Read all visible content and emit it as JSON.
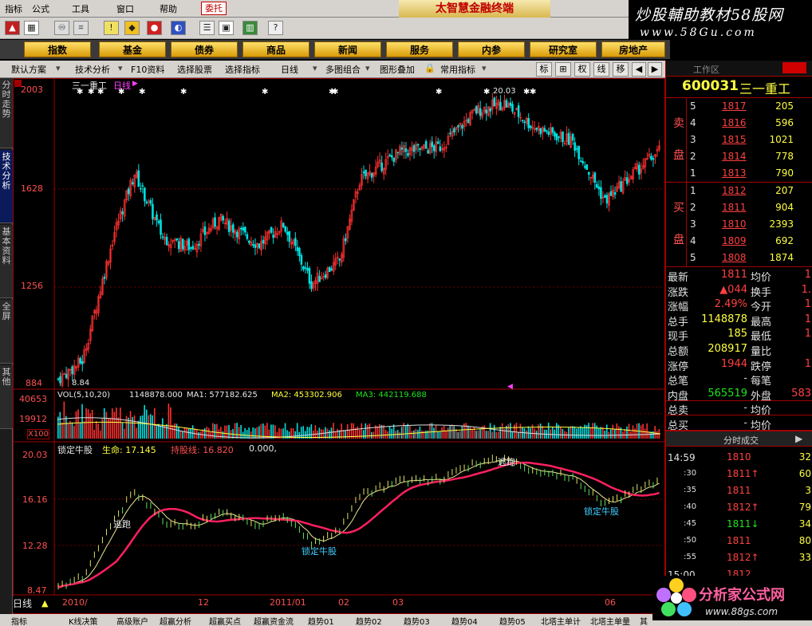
{
  "menubar": {
    "items": [
      "指标",
      "公式",
      "工具",
      "窗口",
      "帮助"
    ],
    "wt": "委托",
    "title": "太智慧金融终端"
  },
  "brand": {
    "line1": "炒股輔助教材58股网",
    "line2": "www.58Gu.com"
  },
  "nav": [
    "指数",
    "基金",
    "债券",
    "商品",
    "新闻",
    "服务",
    "内参",
    "研究室",
    "房地产"
  ],
  "toolbar2": {
    "items": [
      "默认方案",
      "技术分析",
      "F10资料",
      "选择股票",
      "选择指标",
      "日线",
      "多图组合",
      "图形叠加",
      "常用指标"
    ],
    "right": [
      "标",
      "窗",
      "权",
      "线",
      "移"
    ]
  },
  "sidebar": [
    {
      "label": "分时走势"
    },
    {
      "label": "技术分析"
    },
    {
      "label": "基本资料"
    },
    {
      "label": "全屏"
    },
    {
      "label": "其他"
    }
  ],
  "kline": {
    "title": "三一重工",
    "period": "日线",
    "high_mark": "20.03",
    "low_mark": "8.84",
    "yticks": [
      "2003",
      "1628",
      "1256",
      "884"
    ]
  },
  "vol": {
    "label": "VOL(5,10,20)",
    "val": "1148878.000",
    "ma1": "MA1: 577182.625",
    "ma2": "MA2: 453302.906",
    "ma3": "MA3: 442119.688",
    "yticks": [
      "40653",
      "19912",
      "X100"
    ]
  },
  "ind": {
    "name": "锁定牛股",
    "s1": "生命: 17.145",
    "s2": "持股线: 16.820",
    "s3": "0.000,",
    "yticks": [
      "20.03",
      "16.16",
      "12.28",
      "8.47"
    ],
    "ann": [
      "逃跑",
      "逃跑",
      "锁定牛股",
      "锁定牛股"
    ]
  },
  "xaxis": {
    "period": "日线",
    "labels": [
      "2010/",
      "12",
      "2011/01",
      "02",
      "03",
      "",
      "06"
    ]
  },
  "quote": {
    "area": "工作区",
    "code": "600031",
    "name": "三一重工",
    "sell_label": [
      "卖",
      "盘"
    ],
    "buy_label": [
      "买",
      "盘"
    ],
    "sells": [
      {
        "lv": "5",
        "p": "1817",
        "v": "205"
      },
      {
        "lv": "4",
        "p": "1816",
        "v": "596"
      },
      {
        "lv": "3",
        "p": "1815",
        "v": "1021"
      },
      {
        "lv": "2",
        "p": "1814",
        "v": "778"
      },
      {
        "lv": "1",
        "p": "1813",
        "v": "790"
      }
    ],
    "buys": [
      {
        "lv": "1",
        "p": "1812",
        "v": "207"
      },
      {
        "lv": "2",
        "p": "1811",
        "v": "904"
      },
      {
        "lv": "3",
        "p": "1810",
        "v": "2393"
      },
      {
        "lv": "4",
        "p": "1809",
        "v": "692"
      },
      {
        "lv": "5",
        "p": "1808",
        "v": "1874"
      }
    ],
    "stats": [
      {
        "k1": "最新",
        "v1": "1811",
        "k2": "均价",
        "v2": "1"
      },
      {
        "k1": "涨跌",
        "v1": "▲044",
        "k2": "换手",
        "v2": "1."
      },
      {
        "k1": "涨幅",
        "v1": "2.49%",
        "k2": "今开",
        "v2": "1"
      },
      {
        "k1": "总手",
        "v1": "1148878",
        "k2": "最高",
        "v2": "1"
      },
      {
        "k1": "现手",
        "v1": "185",
        "k2": "最低",
        "v2": "1"
      },
      {
        "k1": "总额",
        "v1": "208917",
        "k2": "量比",
        "v2": ""
      },
      {
        "k1": "涨停",
        "v1": "1944",
        "k2": "跌停",
        "v2": "1"
      },
      {
        "k1": "总笔",
        "v1": "-",
        "k2": "每笔",
        "v2": ""
      },
      {
        "k1": "内盘",
        "v1": "565519",
        "k2": "外盘",
        "v2": "583"
      },
      {
        "k1": "总卖",
        "v1": "-",
        "k2": "均价",
        "v2": ""
      },
      {
        "k1": "总买",
        "v1": "-",
        "k2": "均价",
        "v2": ""
      }
    ],
    "ticks_title": "分时成交",
    "ticks": [
      {
        "t": "14:59",
        "p": "1810",
        "v": "32"
      },
      {
        "t": ":30",
        "p": "1811↑",
        "v": "60"
      },
      {
        "t": ":35",
        "p": "1811",
        "v": "3"
      },
      {
        "t": ":40",
        "p": "1812↑",
        "v": "79"
      },
      {
        "t": ":45",
        "p": "1811↓",
        "v": "34"
      },
      {
        "t": ":50",
        "p": "1811",
        "v": "80"
      },
      {
        "t": ":55",
        "p": "1812↑",
        "v": "33"
      },
      {
        "t": "15:00",
        "p": "1812",
        "v": ""
      }
    ]
  },
  "bottom": [
    "指标",
    "K线决策",
    "高级账户",
    "超赢分析",
    "超赢买点",
    "超赢资金流",
    "趋势01",
    "趋势02",
    "趋势03",
    "趋势04",
    "趋势05",
    "北塔主单计",
    "北塔主单量",
    "其"
  ],
  "logo2": {
    "t1": "分析家公式网",
    "t2": "www.88gs.com"
  },
  "colors": {
    "up": "#ff3030",
    "down": "#00e0e0",
    "ma_red": "#ff2060",
    "ma_yel": "#e0e080"
  }
}
